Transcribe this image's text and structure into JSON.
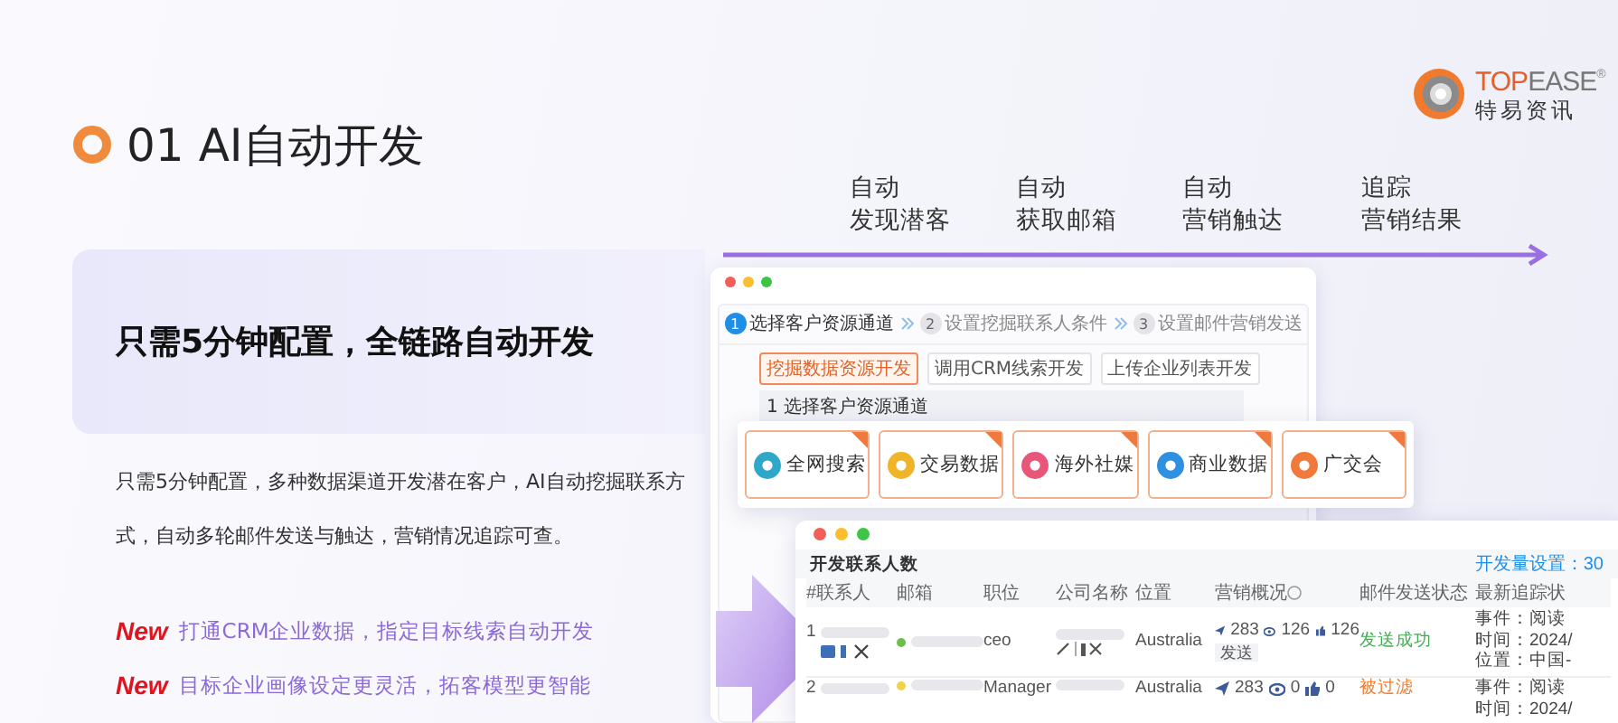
{
  "logo": {
    "brand": [
      {
        "text": "TOP"
      },
      {
        "text": "EASE"
      }
    ],
    "registered": "®",
    "subtitle": "特易资讯"
  },
  "heading": {
    "number": "01",
    "title": "AI自动开发"
  },
  "banner": "只需5分钟配置，全链路自动开发",
  "description": "只需5分钟配置，多种数据渠道开发潜在客户，AI自动挖掘联系方式，自动多轮邮件发送与触达，营销情况追踪可查。",
  "features": [
    {
      "badge": "New",
      "text": "打通CRM企业数据，指定目标线索自动开发"
    },
    {
      "badge": "New",
      "text": "目标企业画像设定更灵活，拓客模型更智能"
    }
  ],
  "timeline": [
    {
      "lines": [
        "自动",
        "发现潜客"
      ]
    },
    {
      "lines": [
        "自动",
        "获取邮箱"
      ]
    },
    {
      "lines": [
        "自动",
        "营销触达"
      ]
    },
    {
      "lines": [
        "追踪",
        "营销结果"
      ]
    }
  ],
  "wizard": {
    "steps": [
      {
        "number": "1",
        "label": "选择客户资源通道",
        "selected": true
      },
      {
        "number": "2",
        "label": "设置挖掘联系人条件",
        "selected": false
      },
      {
        "number": "3",
        "label": "设置邮件营销发送",
        "selected": false
      }
    ],
    "sources": [
      {
        "label": "挖掘数据资源开发",
        "selected": true
      },
      {
        "label": "调用CRM线索开发",
        "selected": false
      },
      {
        "label": "上传企业列表开发",
        "selected": false
      }
    ],
    "section_title": "1 选择客户资源通道",
    "channels": [
      {
        "label": "全网搜索",
        "color": "#2fa7c9"
      },
      {
        "label": "交易数据",
        "color": "#f0b429"
      },
      {
        "label": "海外社媒",
        "color": "#e8577a"
      },
      {
        "label": "商业数据",
        "color": "#2f8fe0"
      },
      {
        "label": "广交会",
        "color": "#ef7a3b"
      }
    ]
  },
  "table": {
    "title": "开发联系人数",
    "setting": "开发量设置：30",
    "columns": [
      "#",
      "联系人",
      "邮箱",
      "职位",
      "公司名称",
      "位置",
      "营销概况",
      "邮件发送状态",
      "最新追踪状"
    ],
    "rows": [
      {
        "number": "1",
        "color": "#6cc04a",
        "title": "ceo",
        "location": "Australia",
        "sent": "283",
        "opened": "126",
        "liked": "126",
        "action": "发送",
        "status": {
          "text": "发送成功",
          "kind": "success"
        },
        "events": [
          "事件：阅读",
          "时间：2024/",
          "位置：中国-"
        ]
      },
      {
        "number": "2",
        "color": "#f2d14b",
        "title": "Manager",
        "location": "Australia",
        "sent": "283",
        "opened": "0",
        "liked": "0",
        "status": {
          "text": "被过滤",
          "kind": "filtered"
        },
        "events": [
          "事件：阅读",
          "时间：2024/"
        ]
      }
    ]
  }
}
